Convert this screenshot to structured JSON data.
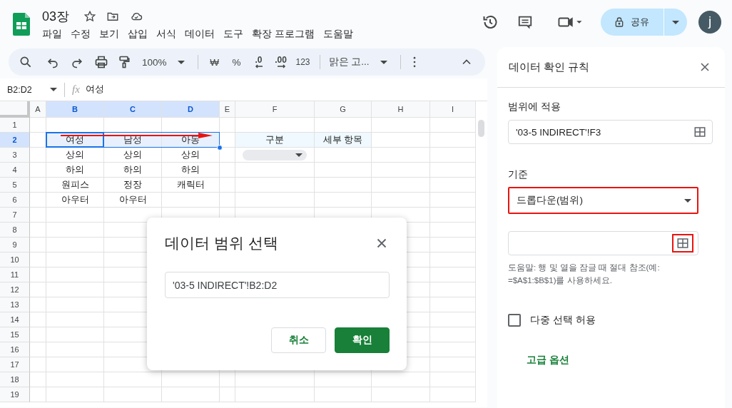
{
  "document": {
    "title": "03장"
  },
  "menu": [
    "파일",
    "수정",
    "보기",
    "삽입",
    "서식",
    "데이터",
    "도구",
    "확장 프로그램",
    "도움말"
  ],
  "share": {
    "label": "공유"
  },
  "account": {
    "initial": "j"
  },
  "toolbar": {
    "zoom": "100%",
    "currency": "₩",
    "percent": "%",
    "decrease_decimal": ".0",
    "increase_decimal": ".00",
    "number_format": "123",
    "font": "맑은 고..."
  },
  "formula_bar": {
    "name_box": "B2:D2",
    "fx": "fx",
    "value": "여성"
  },
  "sheet": {
    "arrow": true,
    "columns": [
      {
        "label": "A",
        "selected": false
      },
      {
        "label": "B",
        "selected": true
      },
      {
        "label": "C",
        "selected": true
      },
      {
        "label": "D",
        "selected": true
      },
      {
        "label": "E",
        "selected": false
      },
      {
        "label": "F",
        "selected": false
      },
      {
        "label": "G",
        "selected": false
      },
      {
        "label": "H",
        "selected": false
      },
      {
        "label": "I",
        "selected": false
      }
    ],
    "rows": [
      {
        "label": "1",
        "selected": false
      },
      {
        "label": "2",
        "selected": true,
        "cells": [
          {
            "kind": "empty",
            "selected": false
          },
          {
            "kind": "text",
            "text": "여성",
            "selected": true
          },
          {
            "kind": "text",
            "text": "남성",
            "selected": true
          },
          {
            "kind": "text",
            "text": "아동",
            "selected": true
          },
          {
            "kind": "empty",
            "selected": false
          },
          {
            "kind": "header",
            "text": "구분",
            "selected": false
          },
          {
            "kind": "header",
            "text": "세부 항목",
            "selected": false
          }
        ]
      },
      {
        "label": "3",
        "selected": false,
        "cells": [
          {
            "kind": "empty",
            "selected": false
          },
          {
            "kind": "text",
            "text": "상의",
            "selected": false
          },
          {
            "kind": "text",
            "text": "상의",
            "selected": false
          },
          {
            "kind": "text",
            "text": "상의",
            "selected": false
          },
          {
            "kind": "empty",
            "selected": false
          },
          {
            "kind": "dropdown",
            "selected": false
          }
        ]
      },
      {
        "label": "4",
        "selected": false,
        "cells": [
          {
            "kind": "empty",
            "selected": false
          },
          {
            "kind": "text",
            "text": "하의",
            "selected": false
          },
          {
            "kind": "text",
            "text": "하의",
            "selected": false
          },
          {
            "kind": "text",
            "text": "하의",
            "selected": false
          }
        ]
      },
      {
        "label": "5",
        "selected": false,
        "cells": [
          {
            "kind": "empty",
            "selected": false
          },
          {
            "kind": "text",
            "text": "원피스",
            "selected": false
          },
          {
            "kind": "text",
            "text": "정장",
            "selected": false
          },
          {
            "kind": "text",
            "text": "캐릭터",
            "selected": false
          }
        ]
      },
      {
        "label": "6",
        "selected": false,
        "cells": [
          {
            "kind": "empty",
            "selected": false
          },
          {
            "kind": "text",
            "text": "아우터",
            "selected": false
          },
          {
            "kind": "text",
            "text": "아우터",
            "selected": false
          }
        ]
      },
      {
        "label": "7",
        "selected": false
      },
      {
        "label": "8",
        "selected": false
      },
      {
        "label": "9",
        "selected": false
      },
      {
        "label": "10",
        "selected": false
      },
      {
        "label": "11",
        "selected": false
      },
      {
        "label": "12",
        "selected": false
      },
      {
        "label": "13",
        "selected": false
      },
      {
        "label": "14",
        "selected": false
      },
      {
        "label": "15",
        "selected": false
      },
      {
        "label": "16",
        "selected": false
      },
      {
        "label": "17",
        "selected": false
      },
      {
        "label": "18",
        "selected": false
      },
      {
        "label": "19",
        "selected": false
      }
    ]
  },
  "panel": {
    "title": "데이터 확인 규칙",
    "range": {
      "label": "범위에 적용",
      "value": "'03-5 INDIRECT'!F3"
    },
    "criteria": {
      "label": "기준",
      "value": "드롭다운(범위)",
      "highlighted": true
    },
    "source": {
      "button_highlighted": true
    },
    "help": "도움말: 행 및 열을 잠글 때 절대 참조(예:\n=$A$1:$B$1)를 사용하세요.",
    "multi_select": {
      "label": "다중 선택 허용",
      "checked": false
    },
    "advanced": "고급 옵션"
  },
  "dialog": {
    "title": "데이터 범위 선택",
    "value": "'03-5 INDIRECT'!B2:D2",
    "buttons": [
      {
        "label": "취소",
        "kind": "secondary"
      },
      {
        "label": "확인",
        "kind": "primary"
      }
    ]
  }
}
